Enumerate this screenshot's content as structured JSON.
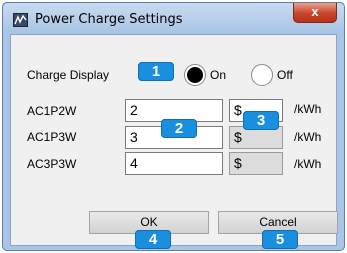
{
  "window": {
    "title": "Power Charge Settings",
    "close_label": "x"
  },
  "charge_display": {
    "label": "Charge Display",
    "on_label": "On",
    "off_label": "Off",
    "selected": "On"
  },
  "rows": [
    {
      "label": "AC1P2W",
      "value": "2",
      "currency": "$",
      "unit": "/kWh"
    },
    {
      "label": "AC1P3W",
      "value": "3",
      "currency": "$",
      "unit": "/kWh"
    },
    {
      "label": "AC3P3W",
      "value": "4",
      "currency": "$",
      "unit": "/kWh"
    }
  ],
  "buttons": {
    "ok": "OK",
    "cancel": "Cancel"
  },
  "callouts": [
    "1",
    "2",
    "3",
    "4",
    "5"
  ],
  "colors": {
    "callout": "#1a8fe0",
    "titlebar": "#a9c4e4",
    "close": "#c8452a"
  }
}
